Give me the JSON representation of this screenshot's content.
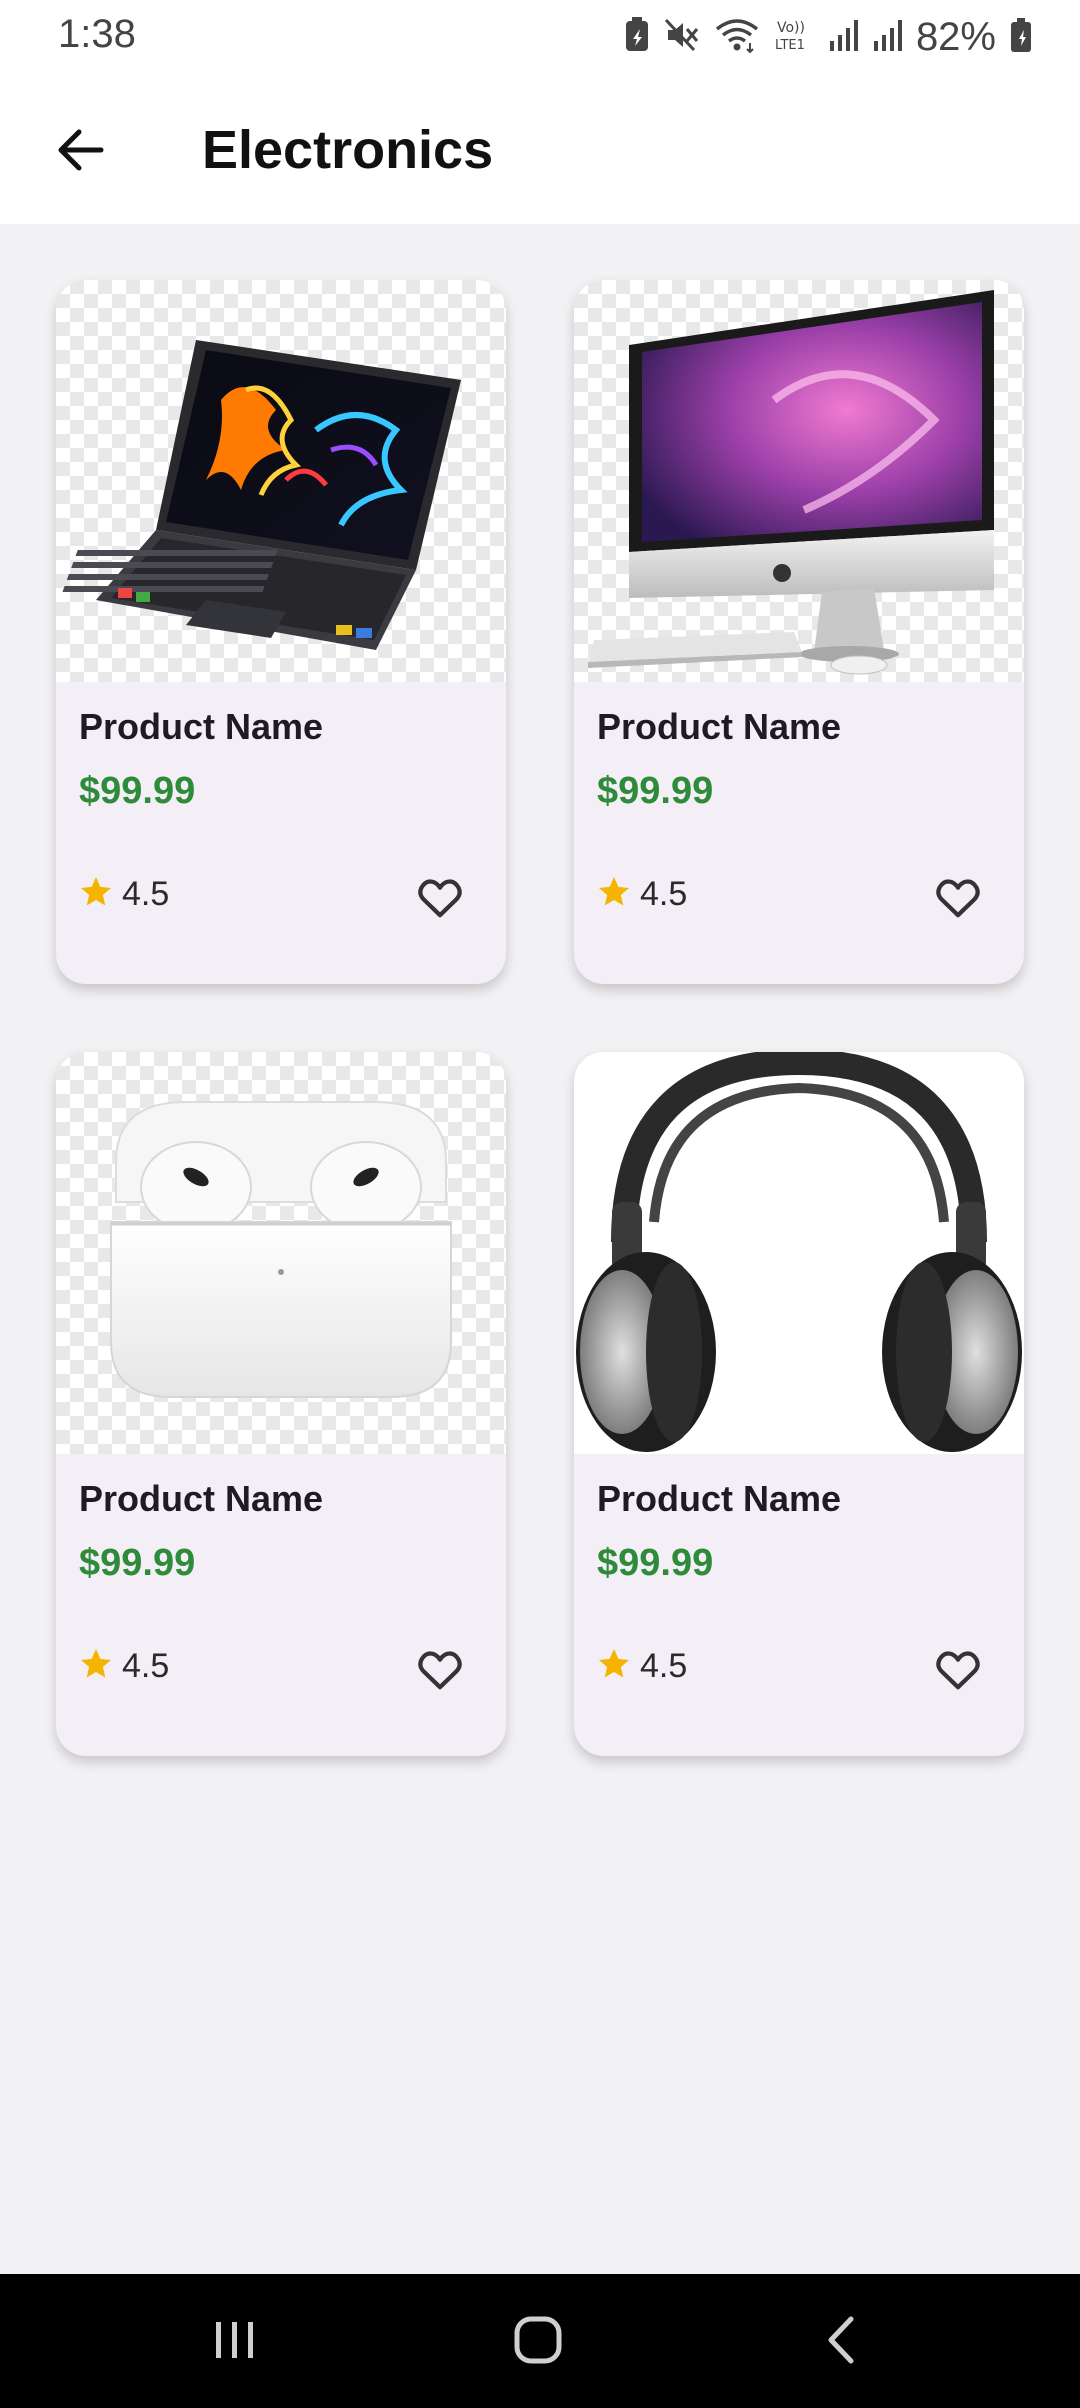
{
  "status_bar": {
    "time": "1:38",
    "battery": "82%",
    "icons": [
      "battery-saver-icon",
      "mute-icon",
      "wifi-icon",
      "volte-icon",
      "signal-icon",
      "signal-icon",
      "battery-icon"
    ]
  },
  "app_bar": {
    "title": "Electronics",
    "back_icon": "arrow-back-icon"
  },
  "products": [
    {
      "name": "Product Name",
      "price": "$99.99",
      "rating": "4.5",
      "image": "laptop",
      "favorited": false
    },
    {
      "name": "Product Name",
      "price": "$99.99",
      "rating": "4.5",
      "image": "desktop-monitor",
      "favorited": false
    },
    {
      "name": "Product Name",
      "price": "$99.99",
      "rating": "4.5",
      "image": "wireless-earbuds",
      "favorited": false
    },
    {
      "name": "Product Name",
      "price": "$99.99",
      "rating": "4.5",
      "image": "headphones",
      "favorited": false
    }
  ],
  "colors": {
    "price": "#2e8b3a",
    "star": "#f5b400",
    "card_background": "#f4eff7",
    "page_background": "#f2f2f4",
    "nav_background": "#000000"
  },
  "nav_bar": {
    "buttons": [
      "recents-icon",
      "home-icon",
      "back-icon"
    ]
  }
}
